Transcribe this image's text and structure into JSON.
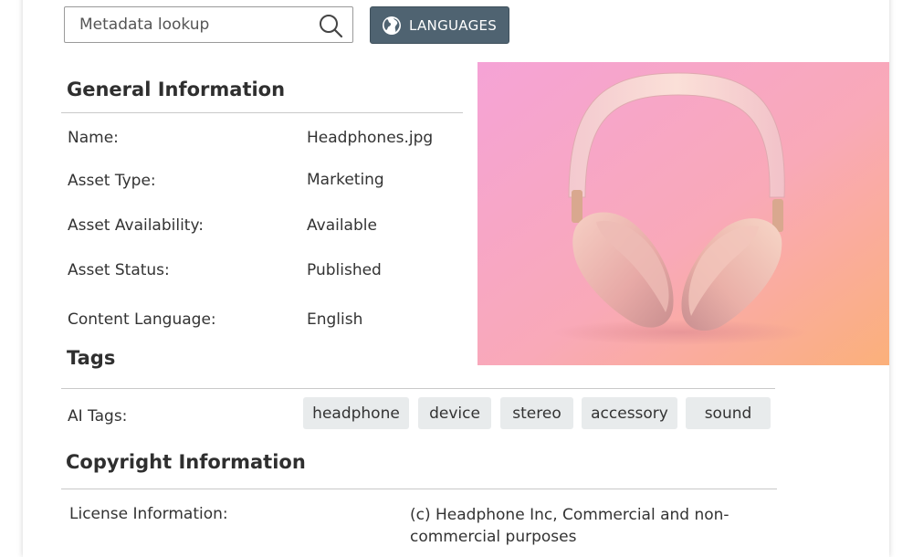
{
  "search": {
    "placeholder": "Metadata lookup"
  },
  "toolbar": {
    "languages_label": "LANGUAGES"
  },
  "general_info": {
    "title": "General Information",
    "rows": [
      {
        "label": "Name:",
        "value": "Headphones.jpg"
      },
      {
        "label": "Asset Type:",
        "value": "Marketing"
      },
      {
        "label": "Asset Availability:",
        "value": "Available"
      },
      {
        "label": "Asset Status:",
        "value": "Published"
      },
      {
        "label": "Content Language:",
        "value": "English"
      }
    ]
  },
  "tags": {
    "title": "Tags",
    "ai_label": "AI Tags:",
    "items": [
      "headphone",
      "device",
      "stereo",
      "accessory",
      "sound"
    ]
  },
  "copyright": {
    "title": "Copyright Information",
    "license_label": "License Information:",
    "license_value": "(c) Headphone Inc, Commercial and non-commercial purposes"
  },
  "colors": {
    "button_bg": "#4f6371",
    "tag_bg": "#e8ebec",
    "rule": "#c9c9c9",
    "image_gradient_start": "#f7a8d0",
    "image_gradient_end": "#f9b07a"
  },
  "icons": {
    "search": "search-icon",
    "globe": "globe-icon"
  }
}
